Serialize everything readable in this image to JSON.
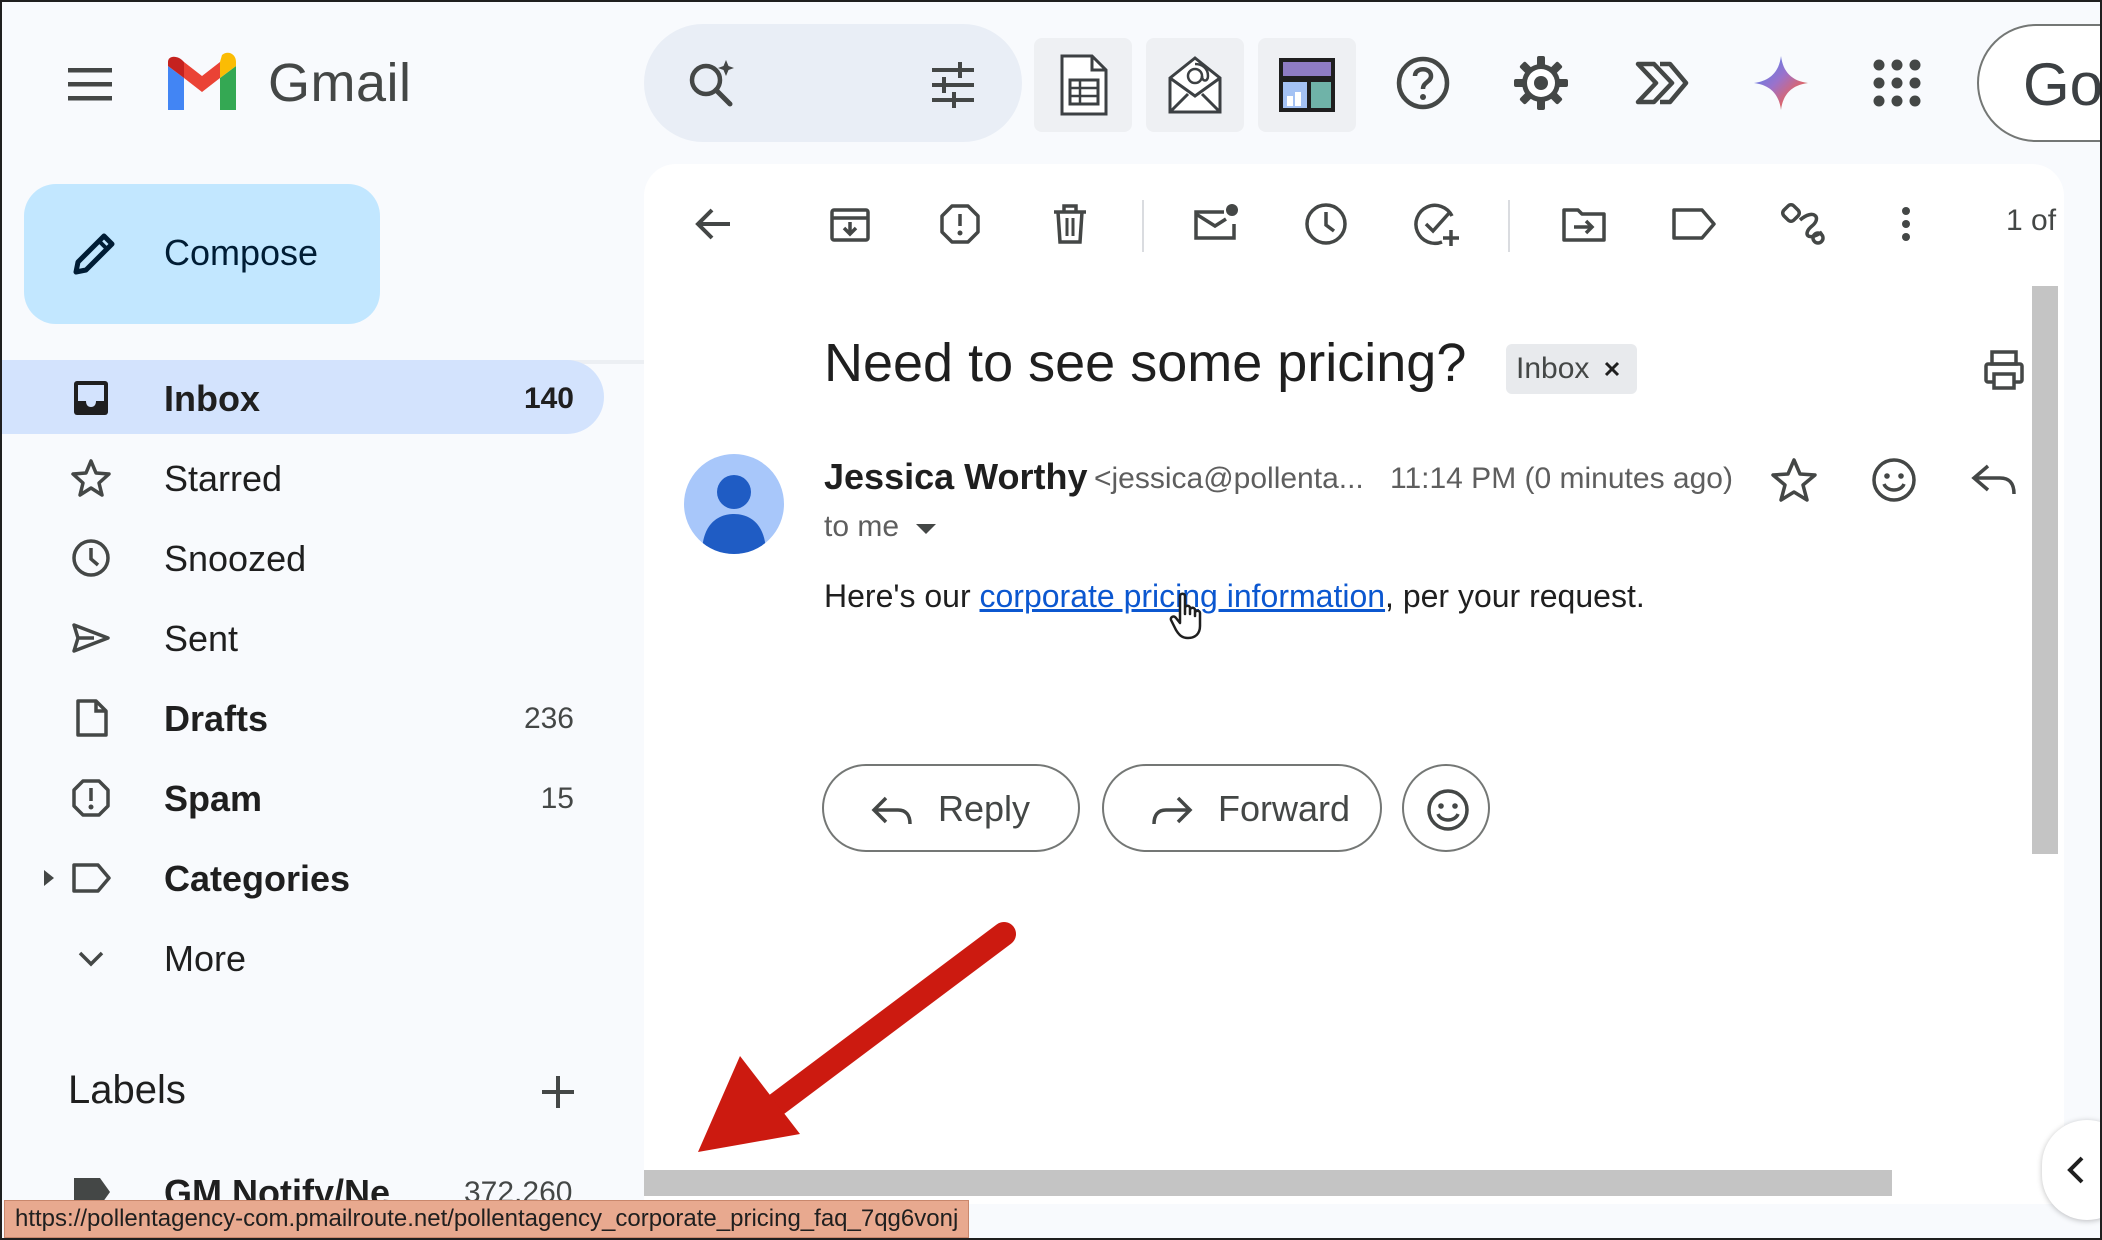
{
  "app": {
    "name": "Gmail",
    "account_initials": "Go"
  },
  "compose": {
    "label": "Compose"
  },
  "sidebar": {
    "items": [
      {
        "label": "Inbox",
        "count": "140",
        "icon": "inbox-icon",
        "active": true,
        "bold": true
      },
      {
        "label": "Starred",
        "count": "",
        "icon": "star-icon",
        "active": false,
        "bold": false
      },
      {
        "label": "Snoozed",
        "count": "",
        "icon": "clock-icon",
        "active": false,
        "bold": false
      },
      {
        "label": "Sent",
        "count": "",
        "icon": "send-icon",
        "active": false,
        "bold": false
      },
      {
        "label": "Drafts",
        "count": "236",
        "icon": "draft-icon",
        "active": false,
        "bold": true
      },
      {
        "label": "Spam",
        "count": "15",
        "icon": "spam-icon",
        "active": false,
        "bold": true
      },
      {
        "label": "Categories",
        "count": "",
        "icon": "label-icon",
        "active": false,
        "bold": true
      },
      {
        "label": "More",
        "count": "",
        "icon": "chevron-down-icon",
        "active": false,
        "bold": false
      }
    ],
    "labels_title": "Labels",
    "partial_label": {
      "name": "GM Notify/Ne",
      "count": "372,260"
    }
  },
  "toolbar": {
    "pager": "1 of"
  },
  "message": {
    "subject": "Need to see some pricing?",
    "chip": "Inbox",
    "sender_name": "Jessica Worthy",
    "sender_email": "<jessica@pollenta...",
    "time": "11:14 PM (0 minutes ago)",
    "to": "to me",
    "body_before": "Here's our ",
    "body_link": "corporate pricing information",
    "body_after": ", per your request."
  },
  "actions": {
    "reply": "Reply",
    "forward": "Forward"
  },
  "status_url": "https://pollentagency-com.pmailroute.net/pollentagency_corporate_pricing_faq_7qg6vonj",
  "colors": {
    "compose_bg": "#c2e7ff",
    "active_nav_bg": "#d3e3fd",
    "link": "#0b57d0",
    "annotation_arrow": "#cc1a10",
    "status_bar_bg": "#e8a98f"
  }
}
